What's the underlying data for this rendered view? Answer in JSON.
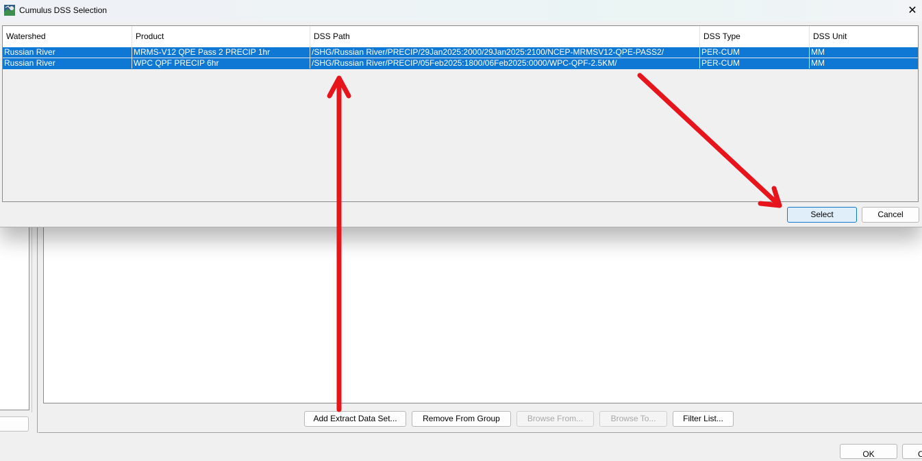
{
  "dialog": {
    "title": "Cumulus DSS Selection",
    "close_label": "✕",
    "columns": [
      "Watershed",
      "Product",
      "DSS Path",
      "DSS Type",
      "DSS Unit"
    ],
    "rows": [
      {
        "watershed": "Russian River",
        "product": "MRMS-V12 QPE Pass 2 PRECIP 1hr",
        "dss_path": "/SHG/Russian River/PRECIP/29Jan2025:2000/29Jan2025:2100/NCEP-MRMSV12-QPE-PASS2/",
        "dss_type": "PER-CUM",
        "dss_unit": "MM",
        "selected": true
      },
      {
        "watershed": "Russian River",
        "product": "WPC QPF PRECIP 6hr",
        "dss_path": "/SHG/Russian River/PRECIP/05Feb2025:1800/06Feb2025:0000/WPC-QPF-2.5KM/",
        "dss_type": "PER-CUM",
        "dss_unit": "MM",
        "selected": true
      }
    ],
    "select_label": "Select",
    "cancel_label": "Cancel"
  },
  "background": {
    "left_button_label": ".",
    "buttons": {
      "add_extract": "Add Extract Data Set...",
      "remove_from_group": "Remove From Group",
      "browse_from": "Browse From...",
      "browse_to": "Browse To...",
      "filter_list": "Filter List..."
    },
    "ok_label": "OK",
    "cut_label": "C"
  },
  "colors": {
    "selection": "#0f78d4",
    "annotation_arrow": "#e8141c",
    "select_button_bg": "#e0eef9"
  },
  "icons": {
    "app": "cumulus-app-icon",
    "close": "close-icon"
  }
}
